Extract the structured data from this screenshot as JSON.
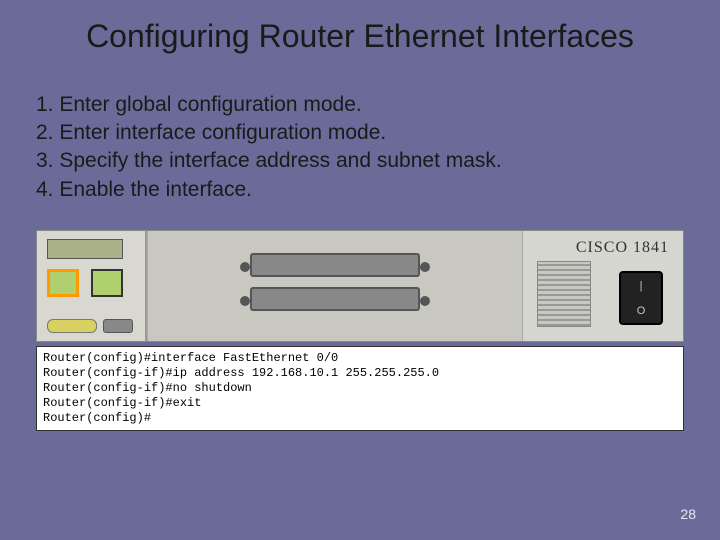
{
  "title": "Configuring Router Ethernet Interfaces",
  "steps": [
    "1. Enter global configuration mode.",
    "2. Enter interface configuration mode.",
    "3. Specify the interface address and subnet mask.",
    "4. Enable the interface."
  ],
  "router": {
    "model_label": "CISCO 1841",
    "power_on": "|",
    "power_off": "O"
  },
  "cli": {
    "lines": [
      {
        "prompt": "Router(config)#",
        "cmd": "interface FastEthernet 0/0"
      },
      {
        "prompt": "Router(config-if)#",
        "cmd": "ip address 192.168.10.1 255.255.255.0"
      },
      {
        "prompt": "Router(config-if)#",
        "cmd": "no shutdown"
      },
      {
        "prompt": "Router(config-if)#",
        "cmd": "exit"
      },
      {
        "prompt": "Router(config)#",
        "cmd": ""
      }
    ]
  },
  "page_number": "28"
}
